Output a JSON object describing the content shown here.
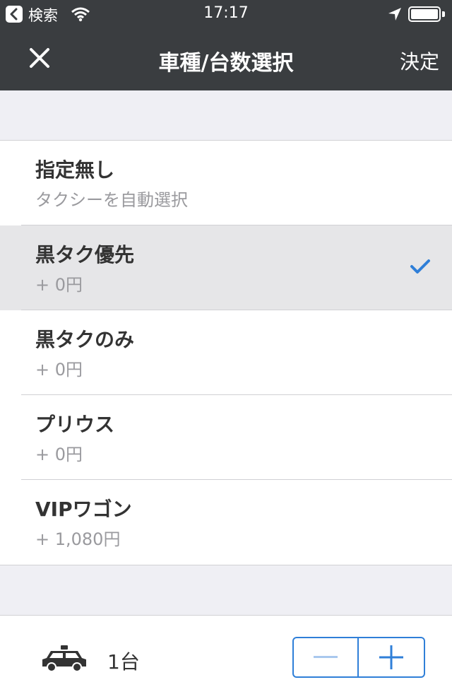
{
  "status_bar": {
    "back_label": "検索",
    "time": "17:17"
  },
  "nav": {
    "title": "車種/台数選択",
    "done_label": "決定"
  },
  "options": [
    {
      "name": "指定無し",
      "sub": "タクシーを自動選択",
      "selected": false
    },
    {
      "name": "黒タク優先",
      "sub": "+ 0円",
      "selected": true
    },
    {
      "name": "黒タクのみ",
      "sub": "+ 0円",
      "selected": false
    },
    {
      "name": "プリウス",
      "sub": "+ 0円",
      "selected": false
    },
    {
      "name": "VIPワゴン",
      "sub": "+ 1,080円",
      "selected": false
    }
  ],
  "bottom": {
    "count_label": "1台"
  },
  "colors": {
    "bar_bg": "#3a3d40",
    "accent": "#2f7fd8",
    "selected_row": "#e6e6e8",
    "page_bg": "#efeff4"
  }
}
